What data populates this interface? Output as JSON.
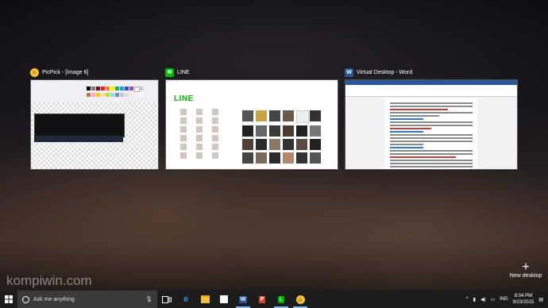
{
  "windows": [
    {
      "app": "PicPick",
      "title": "PicPick - [Image 6]",
      "icon": "picpick-icon"
    },
    {
      "app": "LINE",
      "title": "LINE",
      "icon": "line-icon",
      "logo_text": "LINE"
    },
    {
      "app": "Word",
      "title": "Virtual Desktop - Word",
      "icon": "word-icon"
    }
  ],
  "new_desktop": {
    "label": "New desktop"
  },
  "watermark": "kompiwin.com",
  "taskbar": {
    "search_placeholder": "Ask me anything",
    "language": "IND",
    "time": "8:04 PM",
    "date": "9/23/2015",
    "pinned": [
      "task-view-icon",
      "edge-icon",
      "file-explorer-icon",
      "store-icon",
      "word-icon",
      "powerpoint-icon",
      "line-icon",
      "picpick-icon"
    ]
  },
  "colors": {
    "taskbar": "#1c1c1c",
    "line_green": "#00b900",
    "word_blue": "#2b579a"
  }
}
